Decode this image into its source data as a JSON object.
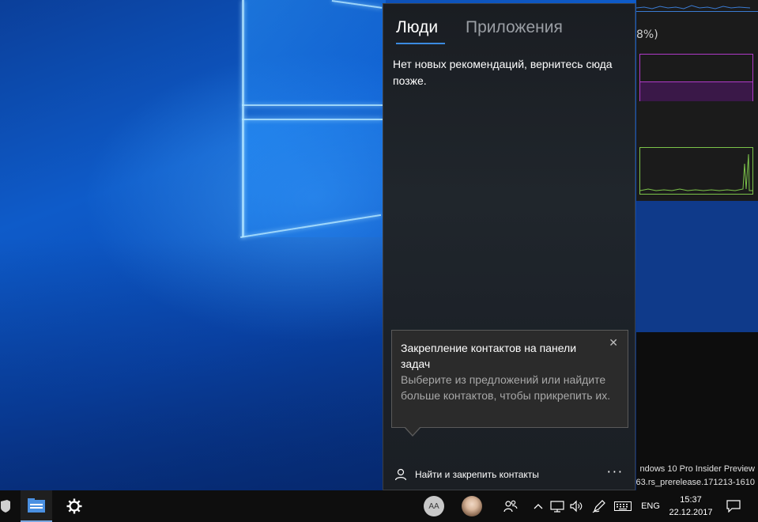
{
  "flyout": {
    "tabs": [
      {
        "label": "Люди",
        "active": true
      },
      {
        "label": "Приложения",
        "active": false
      }
    ],
    "no_recommendations": "Нет новых рекомендаций, вернитесь сюда позже.",
    "tip": {
      "title": "Закрепление контактов на панели задач",
      "body": "Выберите из предложений или найдите больше контактов, чтобы прикрепить их.",
      "close_glyph": "✕"
    },
    "find_pin_label": "Найти и закрепить контакты",
    "more_glyph": "···"
  },
  "background_window": {
    "percent_text": "8%)",
    "watermark_line1": "ndows 10 Pro Insider Preview",
    "watermark_line2": "63.rs_prerelease.171213-1610"
  },
  "taskbar": {
    "avatar_initials": "AA",
    "language": "ENG",
    "time": "15:37",
    "date": "22.12.2017",
    "icons": [
      "shield-icon",
      "file-explorer-icon",
      "settings-gear-icon",
      "people-icon",
      "chevron-up-icon",
      "network-icon",
      "volume-icon",
      "pen-icon",
      "keyboard-icon",
      "notification-icon"
    ]
  },
  "colors": {
    "accent": "#3b8be0",
    "flyout_bg": "#1c2127",
    "tip_bg": "#2b2b2b",
    "taskbar_bg": "#0e0e0e"
  }
}
